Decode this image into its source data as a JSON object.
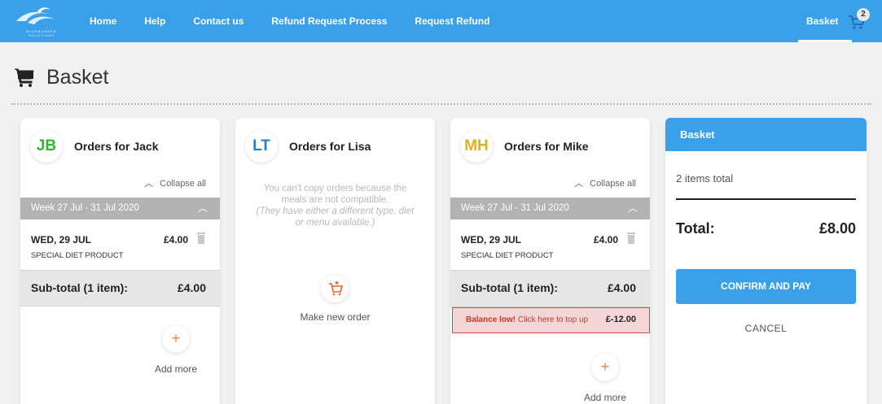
{
  "nav": {
    "logo_text": "BLUEBUNNER SOLUTIONS",
    "links": [
      "Home",
      "Help",
      "Contact us",
      "Refund Request Process",
      "Request Refund"
    ],
    "basket_label": "Basket",
    "basket_badge": "2",
    "brand_color": "#3aa0ea"
  },
  "page": {
    "title": "Basket",
    "icon": "shopping-cart-icon"
  },
  "cards": {
    "jack": {
      "initials": "JB",
      "initials_color": "#2eb82e",
      "title": "Orders for Jack",
      "collapse": "Collapse all",
      "week": "Week 27 Jul - 31 Jul 2020",
      "day": "WED, 29 JUL",
      "price": "£4.00",
      "product": "SPECIAL DIET PRODUCT",
      "subtotal_label": "Sub-total (1 item):",
      "subtotal_value": "£4.00",
      "add_more": "Add more"
    },
    "lisa": {
      "initials": "LT",
      "initials_color": "#1f7fd6",
      "title": "Orders for Lisa",
      "notice_line1": "You can't copy orders because the meals are not compatible.",
      "notice_line2": "(They have either a different type, diet or menu available.)",
      "make_new": "Make new order"
    },
    "mike": {
      "initials": "MH",
      "initials_color": "#e0b21a",
      "title": "Orders for Mike",
      "collapse": "Collapse all",
      "week": "Week 27 Jul - 31 Jul 2020",
      "day": "WED, 29 JUL",
      "price": "£4.00",
      "product": "SPECIAL DIET PRODUCT",
      "subtotal_label": "Sub-total (1 item):",
      "subtotal_value": "£4.00",
      "balance_bold": "Balance low!",
      "balance_rest": " Click here to top up",
      "balance_value": "£-12.00",
      "add_more": "Add more"
    }
  },
  "basket": {
    "header": "Basket",
    "items_total": "2 items total",
    "total_label": "Total:",
    "total_value": "£8.00",
    "confirm": "CONFIRM AND PAY",
    "cancel": "CANCEL"
  }
}
